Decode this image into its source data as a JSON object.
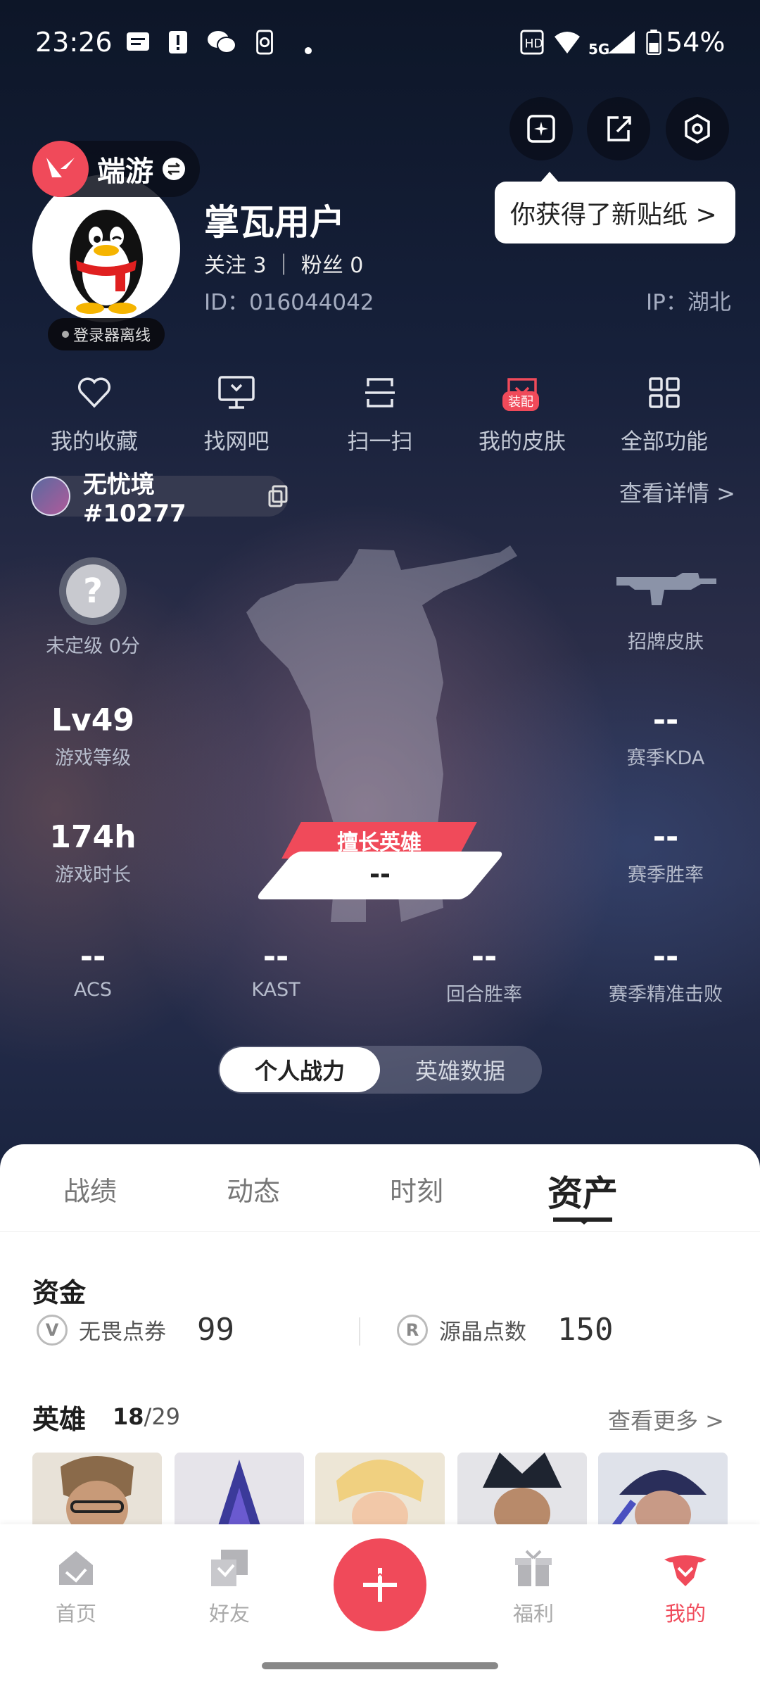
{
  "status_bar": {
    "time": "23:26",
    "network": "5G",
    "battery": "54%"
  },
  "header": {
    "game_tag": "端游",
    "tooltip": "你获得了新贴纸 >",
    "username": "掌瓦用户",
    "follow_line": "关注 3 ｜ 粉丝 0",
    "user_id": "ID：016044042",
    "ip": "IP：湖北",
    "offline_status": "登录器离线"
  },
  "quick_actions": [
    {
      "label": "我的收藏",
      "icon": "heart-icon"
    },
    {
      "label": "找网吧",
      "icon": "monitor-icon"
    },
    {
      "label": "扫一扫",
      "icon": "scan-icon"
    },
    {
      "label": "我的皮肤",
      "icon": "skin-icon",
      "badge": "装配"
    },
    {
      "label": "全部功能",
      "icon": "grid-icon"
    }
  ],
  "riot_account": {
    "name": "无忧境#10277",
    "detail_link": "查看详情 >"
  },
  "stats": {
    "rank": {
      "value": "未定级 0分"
    },
    "signature_skin": {
      "label": "招牌皮肤"
    },
    "level": {
      "value": "Lv49",
      "label": "游戏等级"
    },
    "kda": {
      "value": "--",
      "label": "赛季KDA"
    },
    "playtime": {
      "value": "174h",
      "label": "游戏时长"
    },
    "winrate": {
      "value": "--",
      "label": "赛季胜率"
    },
    "best_hero": {
      "label": "擅长英雄",
      "value": "--"
    },
    "bottom_row": [
      {
        "value": "--",
        "label": "ACS"
      },
      {
        "value": "--",
        "label": "KAST"
      },
      {
        "value": "--",
        "label": "回合胜率"
      },
      {
        "value": "--",
        "label": "赛季精准击败"
      }
    ]
  },
  "view_toggle": {
    "active": "个人战力",
    "inactive": "英雄数据"
  },
  "tabs": [
    "战绩",
    "动态",
    "时刻",
    "资产"
  ],
  "assets": {
    "funds_title": "资金",
    "currencies": [
      {
        "name": "无畏点券",
        "value": "99",
        "icon": "vp-icon"
      },
      {
        "name": "源晶点数",
        "value": "150",
        "icon": "radianite-icon"
      }
    ],
    "heroes_title": "英雄",
    "heroes_count": "18",
    "heroes_total": "/29",
    "see_more": "查看更多 >"
  },
  "bottom_nav": [
    {
      "label": "首页",
      "icon": "home-icon"
    },
    {
      "label": "好友",
      "icon": "friends-icon"
    },
    {
      "label": "福利",
      "icon": "gift-icon"
    },
    {
      "label": "我的",
      "icon": "profile-icon",
      "active": true
    }
  ],
  "colors": {
    "accent": "#f04a5a",
    "background_dark": "#0c1426"
  }
}
